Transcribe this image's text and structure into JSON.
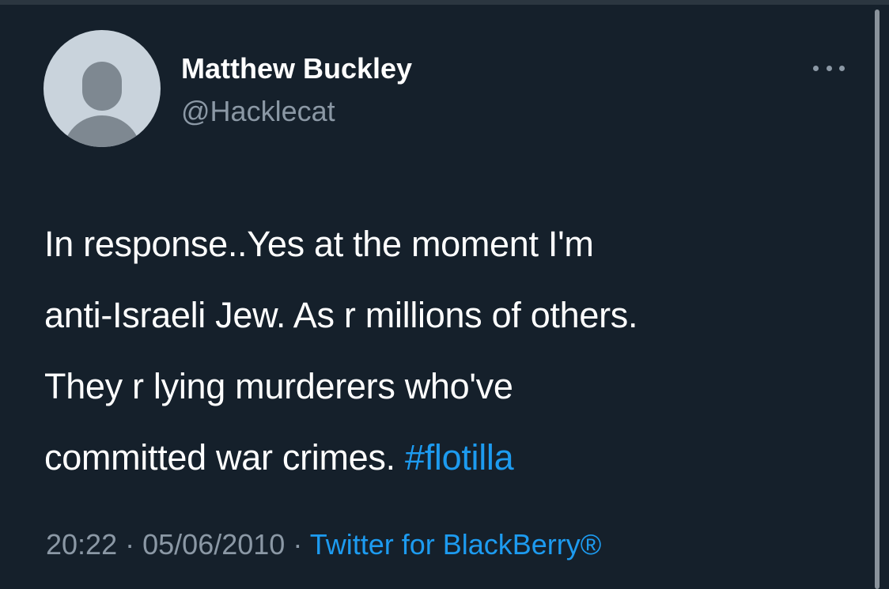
{
  "tweet": {
    "author": {
      "display_name": "Matthew Buckley",
      "handle": "@Hacklecat",
      "avatar_icon": "default-avatar-icon"
    },
    "more_icon": "more-horizontal-icon",
    "text_lines": [
      "In response..Yes at the moment I'm",
      "anti-Israeli Jew. As r millions of others.",
      "They r lying murderers who've",
      "committed war crimes. "
    ],
    "hashtag": "#flotilla",
    "time": "20:22",
    "date": "05/06/2010",
    "separator": "·",
    "source": "Twitter for BlackBerry®"
  },
  "colors": {
    "background": "#15202b",
    "primary_text": "#ffffff",
    "secondary_text": "#8b98a5",
    "accent": "#1d9bf0"
  }
}
